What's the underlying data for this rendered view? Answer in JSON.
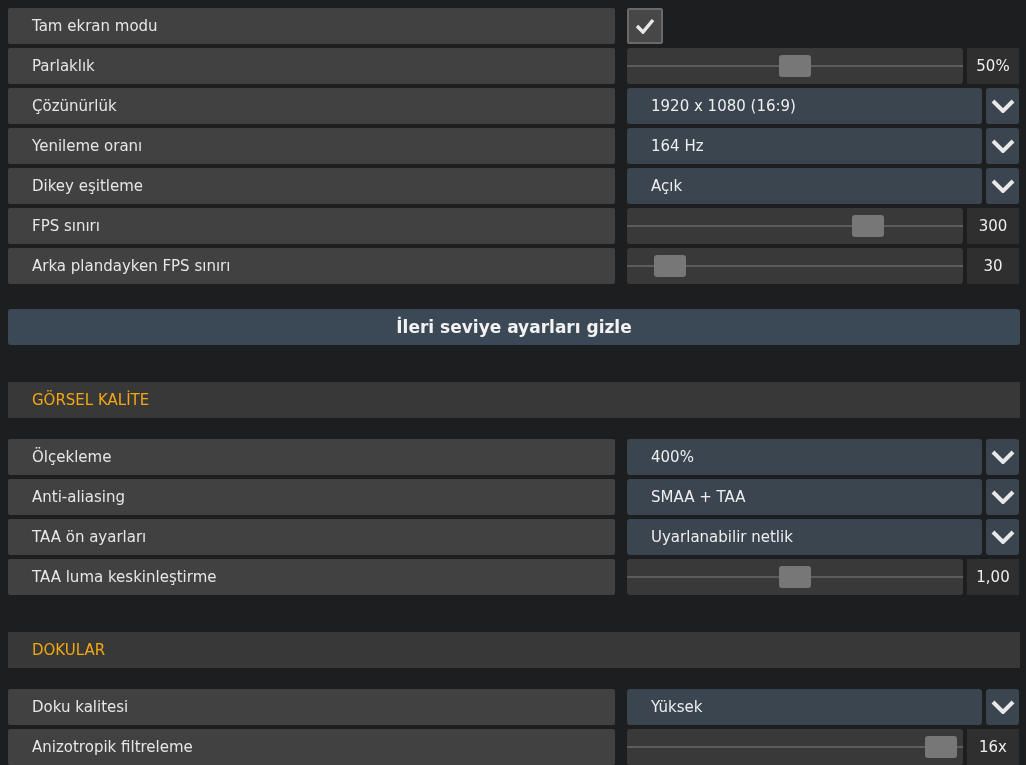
{
  "blocks": [
    {
      "kind": "rows",
      "rows": [
        {
          "kind": "checkbox",
          "label": "Tam ekran modu",
          "checked": true
        },
        {
          "kind": "slider",
          "label": "Parlaklık",
          "level": 0.5,
          "reading": "50%"
        },
        {
          "kind": "dropdown",
          "label": "Çözünürlük",
          "value": "1920 x 1080 (16:9)"
        },
        {
          "kind": "dropdown",
          "label": "Yenileme oranı",
          "value": "164 Hz"
        },
        {
          "kind": "dropdown",
          "label": "Dikey eşitleme",
          "value": "Açık"
        },
        {
          "kind": "slider",
          "label": "FPS sınırı",
          "level": 0.74,
          "reading": "300"
        },
        {
          "kind": "slider",
          "label": "Arka plandayken FPS sınırı",
          "level": 0.09,
          "reading": "30"
        }
      ]
    },
    {
      "kind": "button",
      "label": "İleri seviye ayarları gizle"
    },
    {
      "kind": "section",
      "title": "GÖRSEL KALİTE"
    },
    {
      "kind": "rows",
      "rows": [
        {
          "kind": "dropdown",
          "label": "Ölçekleme",
          "value": "400%"
        },
        {
          "kind": "dropdown",
          "label": "Anti-aliasing",
          "value": "SMAA + TAA"
        },
        {
          "kind": "dropdown",
          "label": "TAA ön ayarları",
          "value": "Uyarlanabilir netlik"
        },
        {
          "kind": "slider",
          "label": "TAA luma keskinleştirme",
          "level": 0.5,
          "reading": "1,00"
        }
      ]
    },
    {
      "kind": "section",
      "title": "DOKULAR"
    },
    {
      "kind": "rows",
      "rows": [
        {
          "kind": "dropdown",
          "label": "Doku kalitesi",
          "value": "Yüksek"
        },
        {
          "kind": "slider",
          "label": "Anizotropik filtreleme",
          "level": 0.98,
          "reading": "16x"
        }
      ]
    }
  ]
}
